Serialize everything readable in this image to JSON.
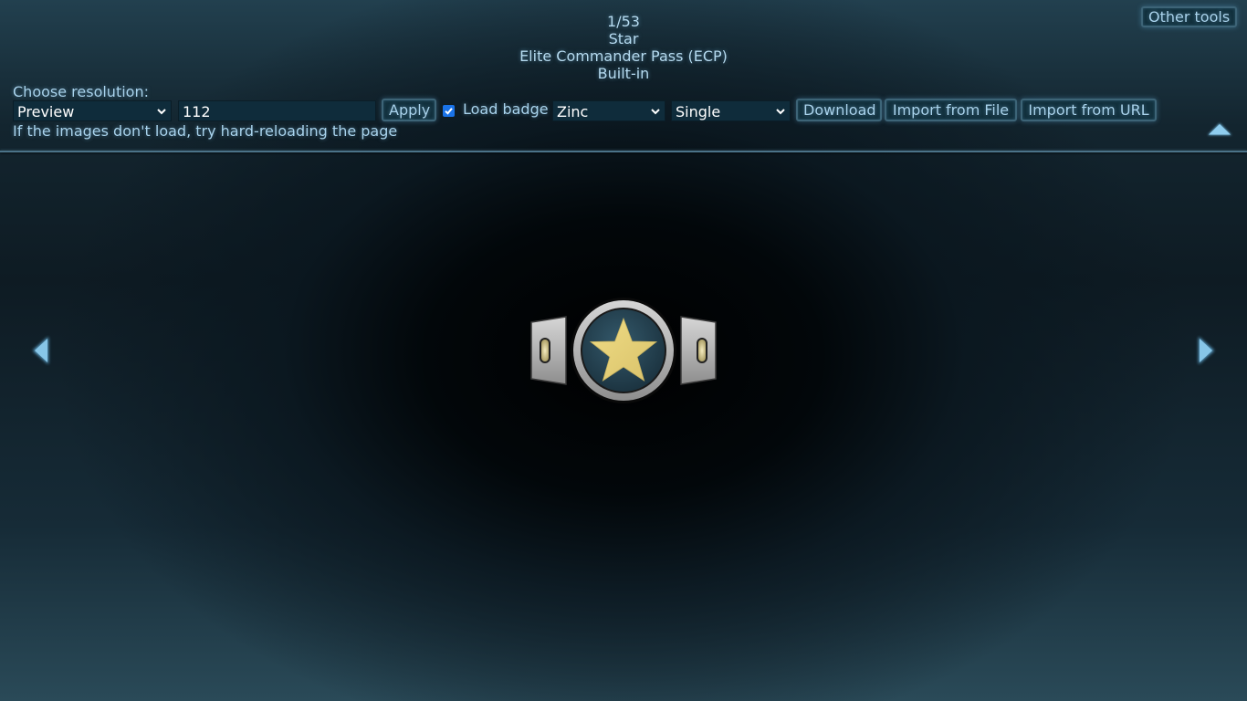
{
  "header": {
    "counter": "1/53",
    "item_name": "Star",
    "pack_name": "Elite Commander Pass (ECP)",
    "source": "Built-in"
  },
  "other_tools_label": "Other tools",
  "resolution": {
    "label": "Choose resolution:",
    "selected": "Preview",
    "custom_value": "112",
    "apply_label": "Apply"
  },
  "load_badge": {
    "checked": true,
    "label": "Load badge",
    "material_selected": "Zinc",
    "mode_selected": "Single"
  },
  "actions": {
    "download_label": "Download",
    "import_file_label": "Import from File",
    "import_url_label": "Import from URL"
  },
  "hint": "If the images don't load, try hard-reloading the page",
  "icons": {
    "collapse": "triangle-up-icon",
    "prev": "triangle-left-icon",
    "next": "triangle-right-icon",
    "preview": "star-badge"
  },
  "colors": {
    "accent_text": "#a9d4ee",
    "input_bg": "#0f2c3b",
    "checkbox": "#1a73e8",
    "star": "#e8d27a",
    "badge_metal": "#b5b5b5",
    "badge_center": "#24414f"
  }
}
